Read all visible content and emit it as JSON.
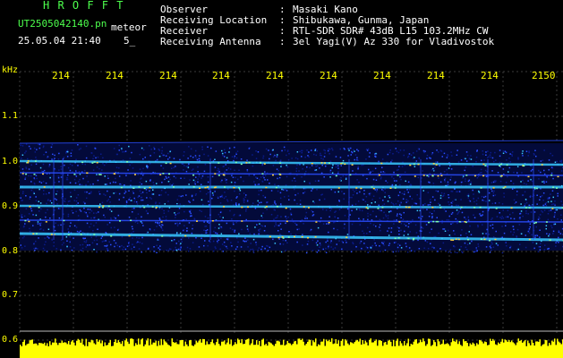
{
  "header": {
    "title": "H R O F F T",
    "filename": "UT2505042140.pn",
    "label": "meteor",
    "date_time": "25.05.04 21:40",
    "count": "5_",
    "fields": [
      {
        "label": "Observer",
        "value": "Masaki Kano"
      },
      {
        "label": "Receiving Location",
        "value": "Shibukawa, Gunma, Japan"
      },
      {
        "label": "Receiver",
        "value": "RTL-SDR SDR# 43dB L15 103.2MHz CW"
      },
      {
        "label": "Receiving Antenna",
        "value": "3el Yagi(V) Az 330 for Vladivostok"
      }
    ],
    "colon": ":"
  },
  "axis": {
    "y_unit": "kHz",
    "y_ticks": [
      "1.1",
      "1.0",
      "0.9",
      "0.8",
      "0.7",
      "0.6"
    ],
    "x_ticks": [
      "214",
      "214",
      "214",
      "214",
      "214",
      "214",
      "214",
      "214",
      "214",
      "2150"
    ]
  },
  "colors": {
    "background": "#000000",
    "header_title": "#4dff4d",
    "header_text": "#ffffff",
    "tick_labels": "#ffff00",
    "grid": "#3a3a3a",
    "noise_dark": "#0a1b8a",
    "noise_mid": "#2a4dff",
    "signal": "#39c9ff",
    "signal_hot": "#ffd23a",
    "level_bar": "#ffff00"
  }
}
